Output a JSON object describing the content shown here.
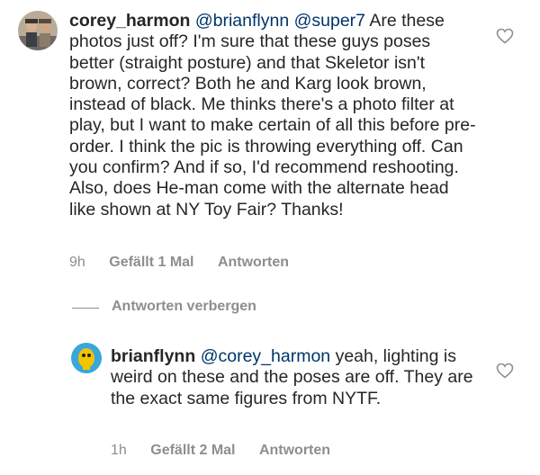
{
  "comment": {
    "username": "corey_harmon",
    "mentions": [
      "@brianflynn",
      "@super7"
    ],
    "text": "Are these photos just off? I'm sure that these guys poses better (straight posture) and that Skeletor isn't brown, correct? Both he and Karg look brown, instead of black. Me thinks there's a photo filter at play, but I want to make certain of all this before pre-order. I think the pic is throwing everything off. Can you confirm? And if so, I'd recommend reshooting. Also, does He-man come with the alternate head like shown at NY Toy Fair? Thanks!",
    "time": "9h",
    "likes_label": "Gefällt 1 Mal",
    "reply_label": "Antworten",
    "icon": "heart-outline-icon"
  },
  "hide_replies_label": "Antworten verbergen",
  "reply": {
    "username": "brianflynn",
    "mention": "@corey_harmon",
    "text": "yeah, lighting is weird on these and the poses are off. They are the exact same figures from NYTF.",
    "time": "1h",
    "likes_label": "Gefällt 2 Mal",
    "reply_label": "Antworten",
    "icon": "heart-outline-icon"
  },
  "colors": {
    "text": "#262626",
    "mention": "#003569",
    "muted": "#8e8e8e"
  }
}
